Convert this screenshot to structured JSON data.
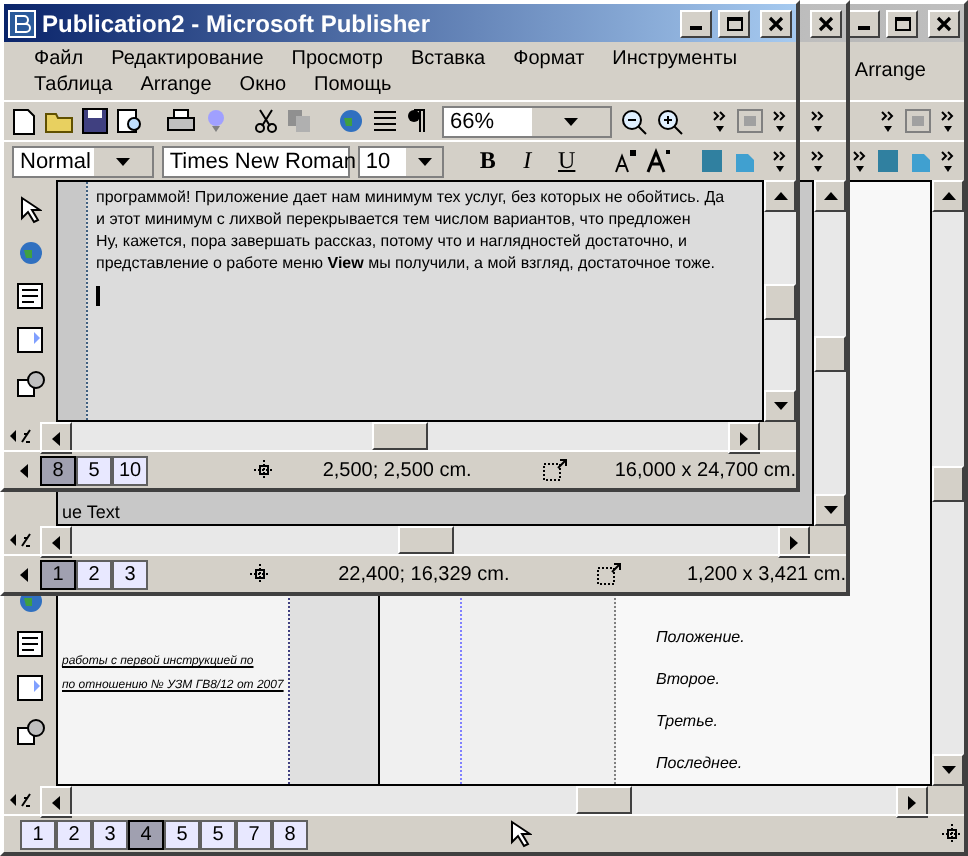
{
  "back_window": {
    "menu": [
      "Arrange"
    ],
    "document": {
      "left_column": [
        "работы с первой инструкцией по",
        "по отношению № УЗМ ГВ8/12 от 2007"
      ],
      "right_column": [
        "Положение.",
        "Второе.",
        "Третье.",
        "Последнее."
      ]
    },
    "page_tabs": [
      {
        "label": "1",
        "selected": false
      },
      {
        "label": "2",
        "selected": false
      },
      {
        "label": "3",
        "selected": false
      },
      {
        "label": "4",
        "selected": true
      },
      {
        "label": "5",
        "selected": false
      },
      {
        "label": "5",
        "selected": false
      },
      {
        "label": "7",
        "selected": false
      },
      {
        "label": "8",
        "selected": false
      }
    ]
  },
  "middle_window": {
    "document": {
      "text": "ue Text"
    },
    "page_tabs": [
      {
        "label": "1",
        "selected": true
      },
      {
        "label": "2",
        "selected": false
      },
      {
        "label": "3",
        "selected": false
      }
    ],
    "position": "22,400; 16,329 cm.",
    "size": "1,200 x 3,421 cm."
  },
  "front_window": {
    "title": "Publication2 - Microsoft Publisher",
    "menu_rows": [
      [
        "Файл",
        "Редактирование",
        "Просмотр",
        "Вставка",
        "Формат",
        "Инструменты"
      ],
      [
        "Таблица",
        "Arrange",
        "Окно",
        "Помощь"
      ]
    ],
    "zoom": "66%",
    "format_bar": {
      "style": "Normal",
      "font": "Times New Roman",
      "size": "10",
      "buttons": [
        "B",
        "I",
        "U"
      ]
    },
    "document": {
      "lines": [
        "программой! Приложение дает нам минимум тех услуг, без которых не обойтись. Да",
        "и этот минимум с лихвой перекрывается тем числом вариантов, что предложен",
        "Ну, кажется, пора завершать рассказ, потому что и наглядностей достаточно, и",
        "представление о работе меню **View** мы получили, а мой взгляд, достаточное тоже."
      ]
    },
    "page_tabs": [
      {
        "label": "8",
        "selected": true
      },
      {
        "label": "5",
        "selected": false
      },
      {
        "label": "10",
        "selected": false
      }
    ],
    "position": "2,500; 2,500 cm.",
    "size": "16,000 x 24,700 cm."
  }
}
